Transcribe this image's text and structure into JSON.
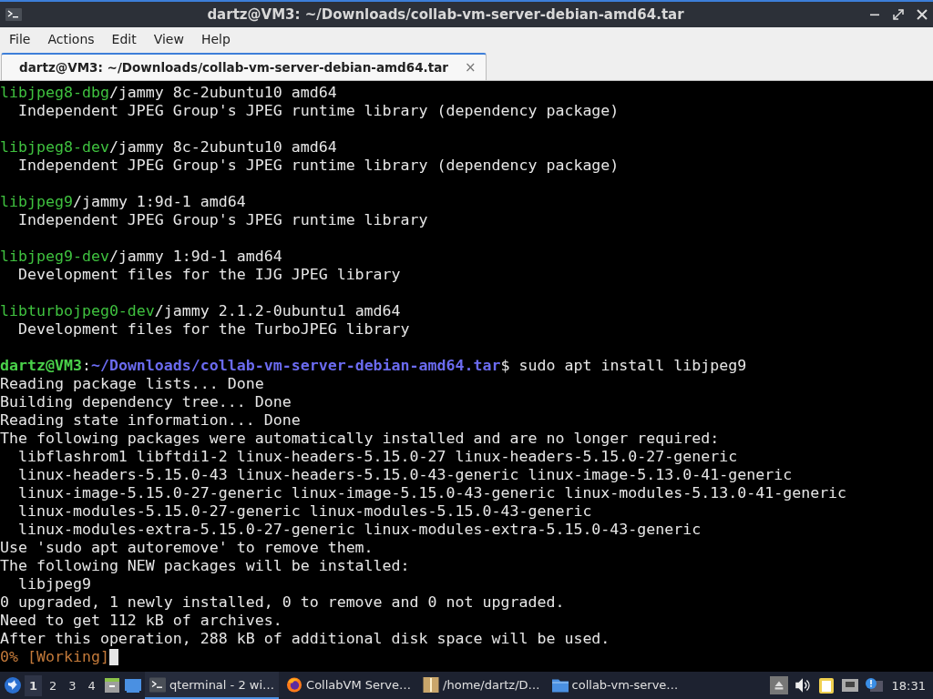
{
  "window": {
    "title": "dartz@VM3: ~/Downloads/collab-vm-server-debian-amd64.tar"
  },
  "menu": [
    "File",
    "Actions",
    "Edit",
    "View",
    "Help"
  ],
  "tabs": [
    {
      "label": "dartz@VM3: ~/Downloads/collab-vm-server-debian-amd64.tar",
      "selected": true,
      "close": "×"
    }
  ],
  "terminal": {
    "lines": [
      {
        "kind": "text",
        "segments": [
          {
            "kind": "pkg",
            "text": "libjpeg8-dbg"
          },
          {
            "kind": "plain",
            "text": "/jammy 8c-2ubuntu10 amd64"
          }
        ]
      },
      {
        "kind": "text",
        "segments": [
          {
            "kind": "plain",
            "text": "  Independent JPEG Group's JPEG runtime library (dependency package)"
          }
        ]
      },
      {
        "kind": "blank"
      },
      {
        "kind": "text",
        "segments": [
          {
            "kind": "pkg",
            "text": "libjpeg8-dev"
          },
          {
            "kind": "plain",
            "text": "/jammy 8c-2ubuntu10 amd64"
          }
        ]
      },
      {
        "kind": "text",
        "segments": [
          {
            "kind": "plain",
            "text": "  Independent JPEG Group's JPEG runtime library (dependency package)"
          }
        ]
      },
      {
        "kind": "blank"
      },
      {
        "kind": "text",
        "segments": [
          {
            "kind": "pkg",
            "text": "libjpeg9"
          },
          {
            "kind": "plain",
            "text": "/jammy 1:9d-1 amd64"
          }
        ]
      },
      {
        "kind": "text",
        "segments": [
          {
            "kind": "plain",
            "text": "  Independent JPEG Group's JPEG runtime library"
          }
        ]
      },
      {
        "kind": "blank"
      },
      {
        "kind": "text",
        "segments": [
          {
            "kind": "pkg",
            "text": "libjpeg9-dev"
          },
          {
            "kind": "plain",
            "text": "/jammy 1:9d-1 amd64"
          }
        ]
      },
      {
        "kind": "text",
        "segments": [
          {
            "kind": "plain",
            "text": "  Development files for the IJG JPEG library"
          }
        ]
      },
      {
        "kind": "blank"
      },
      {
        "kind": "text",
        "segments": [
          {
            "kind": "pkg",
            "text": "libturbojpeg0-dev"
          },
          {
            "kind": "plain",
            "text": "/jammy 2.1.2-0ubuntu1 amd64"
          }
        ]
      },
      {
        "kind": "text",
        "segments": [
          {
            "kind": "plain",
            "text": "  Development files for the TurboJPEG library"
          }
        ]
      },
      {
        "kind": "blank"
      },
      {
        "kind": "text",
        "segments": [
          {
            "kind": "user",
            "text": "dartz@VM3"
          },
          {
            "kind": "plain",
            "text": ":"
          },
          {
            "kind": "path",
            "text": "~/Downloads/collab-vm-server-debian-amd64.tar"
          },
          {
            "kind": "plain",
            "text": "$ sudo apt install libjpeg9"
          }
        ]
      },
      {
        "kind": "text",
        "segments": [
          {
            "kind": "plain",
            "text": "Reading package lists... Done"
          }
        ]
      },
      {
        "kind": "text",
        "segments": [
          {
            "kind": "plain",
            "text": "Building dependency tree... Done"
          }
        ]
      },
      {
        "kind": "text",
        "segments": [
          {
            "kind": "plain",
            "text": "Reading state information... Done"
          }
        ]
      },
      {
        "kind": "text",
        "segments": [
          {
            "kind": "plain",
            "text": "The following packages were automatically installed and are no longer required:"
          }
        ]
      },
      {
        "kind": "text",
        "segments": [
          {
            "kind": "plain",
            "text": "  libflashrom1 libftdi1-2 linux-headers-5.15.0-27 linux-headers-5.15.0-27-generic"
          }
        ]
      },
      {
        "kind": "text",
        "segments": [
          {
            "kind": "plain",
            "text": "  linux-headers-5.15.0-43 linux-headers-5.15.0-43-generic linux-image-5.13.0-41-generic"
          }
        ]
      },
      {
        "kind": "text",
        "segments": [
          {
            "kind": "plain",
            "text": "  linux-image-5.15.0-27-generic linux-image-5.15.0-43-generic linux-modules-5.13.0-41-generic"
          }
        ]
      },
      {
        "kind": "text",
        "segments": [
          {
            "kind": "plain",
            "text": "  linux-modules-5.15.0-27-generic linux-modules-5.15.0-43-generic"
          }
        ]
      },
      {
        "kind": "text",
        "segments": [
          {
            "kind": "plain",
            "text": "  linux-modules-extra-5.15.0-27-generic linux-modules-extra-5.15.0-43-generic"
          }
        ]
      },
      {
        "kind": "text",
        "segments": [
          {
            "kind": "plain",
            "text": "Use 'sudo apt autoremove' to remove them."
          }
        ]
      },
      {
        "kind": "text",
        "segments": [
          {
            "kind": "plain",
            "text": "The following NEW packages will be installed:"
          }
        ]
      },
      {
        "kind": "text",
        "segments": [
          {
            "kind": "plain",
            "text": "  libjpeg9"
          }
        ]
      },
      {
        "kind": "text",
        "segments": [
          {
            "kind": "plain",
            "text": "0 upgraded, 1 newly installed, 0 to remove and 0 not upgraded."
          }
        ]
      },
      {
        "kind": "text",
        "segments": [
          {
            "kind": "plain",
            "text": "Need to get 112 kB of archives."
          }
        ]
      },
      {
        "kind": "text",
        "segments": [
          {
            "kind": "plain",
            "text": "After this operation, 288 kB of additional disk space will be used."
          }
        ]
      },
      {
        "kind": "text",
        "segments": [
          {
            "kind": "progress",
            "text": "0% [Working]"
          }
        ],
        "cursor": true
      }
    ]
  },
  "taskbar": {
    "desktops": [
      {
        "label": "1",
        "selected": true
      },
      {
        "label": "2",
        "selected": false
      },
      {
        "label": "3",
        "selected": false
      },
      {
        "label": "4",
        "selected": false
      }
    ],
    "tasks": [
      {
        "kind": "terminal",
        "label": "qterminal - 2 wi…",
        "selected": true
      },
      {
        "kind": "browser",
        "label": "CollabVM Serve…",
        "selected": false
      },
      {
        "kind": "archive",
        "label": "/home/dartz/D…",
        "selected": false
      },
      {
        "kind": "folder",
        "label": "collab-vm-serve…",
        "selected": false
      }
    ],
    "clock": "18:31"
  }
}
